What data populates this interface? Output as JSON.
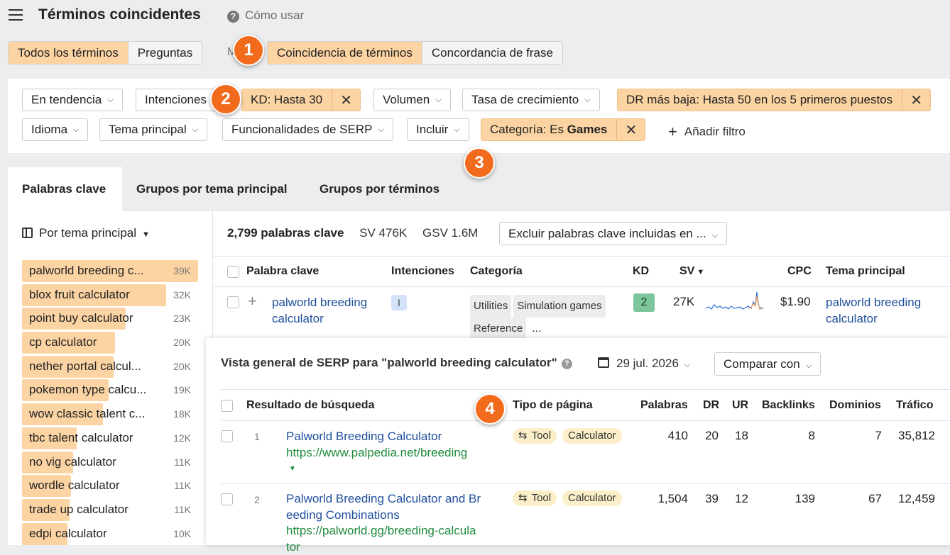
{
  "header": {
    "title": "Términos coincidentes",
    "help": "Cómo usar"
  },
  "mode_tabs": {
    "group1": [
      "Todos los términos",
      "Preguntas"
    ],
    "hidden_letter": "M",
    "group2": [
      "Coincidencia de términos",
      "Concordancia de frase"
    ]
  },
  "filters": {
    "trend": "En tendencia",
    "intents": "Intenciones",
    "kd": "KD: Hasta 30",
    "volume": "Volumen",
    "growth": "Tasa de crecimiento",
    "dr": "DR más baja: Hasta 50 en los 5 primeros puestos",
    "language": "Idioma",
    "parent_topic": "Tema principal",
    "serp_features": "Funcionalidades de SERP",
    "include": "Incluir",
    "category_prefix": "Categoría: Es ",
    "category_value": "Games",
    "add_filter": "Añadir filtro"
  },
  "main_tabs": [
    "Palabras clave",
    "Grupos por tema principal",
    "Grupos por términos"
  ],
  "sidebar": {
    "heading": "Por tema principal",
    "items": [
      {
        "label": "palworld breeding c...",
        "count": "39K",
        "fill": 1.0
      },
      {
        "label": "blox fruit calculator",
        "count": "32K",
        "fill": 0.82
      },
      {
        "label": "point buy calculator",
        "count": "23K",
        "fill": 0.59
      },
      {
        "label": "cp calculator",
        "count": "20K",
        "fill": 0.53
      },
      {
        "label": "nether portal calcul...",
        "count": "20K",
        "fill": 0.52
      },
      {
        "label": "pokemon type calcu...",
        "count": "19K",
        "fill": 0.49
      },
      {
        "label": "wow classic talent c...",
        "count": "18K",
        "fill": 0.46
      },
      {
        "label": "tbc talent calculator",
        "count": "12K",
        "fill": 0.31
      },
      {
        "label": "no vig calculator",
        "count": "11K",
        "fill": 0.29
      },
      {
        "label": "wordle calculator",
        "count": "11K",
        "fill": 0.28
      },
      {
        "label": "trade up calculator",
        "count": "11K",
        "fill": 0.27
      },
      {
        "label": "edpi calculator",
        "count": "10K",
        "fill": 0.26
      }
    ]
  },
  "summary": {
    "count": "2,799 palabras clave",
    "sv": "SV 476K",
    "gsv": "GSV 1.6M",
    "exclude": "Excluir palabras clave incluidas en ..."
  },
  "kw_table": {
    "headers": {
      "keyword": "Palabra clave",
      "intents": "Intenciones",
      "category": "Categoría",
      "kd": "KD",
      "sv": "SV",
      "cpc": "CPC",
      "parent": "Tema principal"
    },
    "row": {
      "keyword_line1": "palworld breeding",
      "keyword_line2": "calculator",
      "intent": "I",
      "tags": [
        "Utilities",
        "Simulation games",
        "Reference"
      ],
      "more": "...",
      "kd": "2",
      "sv": "27K",
      "cpc": "$1.90",
      "parent_line1": "palworld breeding",
      "parent_line2": "calculator",
      "kd_color": "#7dc59a"
    }
  },
  "serp": {
    "title": "Vista general de SERP para \"palworld breeding calculator\"",
    "date": "29 jul. 2026",
    "compare": "Comparar con",
    "headers": {
      "result": "Resultado de búsqueda",
      "page_type": "Tipo de página",
      "words": "Palabras",
      "dr": "DR",
      "ur": "UR",
      "backlinks": "Backlinks",
      "domains": "Dominios",
      "traffic": "Tráfico"
    },
    "rows": [
      {
        "rank": "1",
        "title_line1": "Palworld Breeding Calculator",
        "title_line2": "",
        "url_line1": "https://www.palpedia.net/breeding",
        "url_line2": "",
        "tags": [
          "Tool",
          "Calculator"
        ],
        "words": "410",
        "dr": "20",
        "ur": "18",
        "backlinks": "8",
        "domains": "7",
        "traffic": "35,812"
      },
      {
        "rank": "2",
        "title_line1": "Palworld Breeding Calculator and Br",
        "title_line2": "eeding Combinations",
        "url_line1": "https://palworld.gg/breeding-calcula",
        "url_line2": "tor",
        "tags": [
          "Tool",
          "Calculator"
        ],
        "words": "1,504",
        "dr": "39",
        "ur": "12",
        "backlinks": "139",
        "domains": "67",
        "traffic": "12,459"
      }
    ]
  },
  "callouts": [
    "1",
    "2",
    "3",
    "4"
  ],
  "colors": {
    "accent": "#fcd4a3",
    "callout": "#f26b1d",
    "link": "#1f4f9c",
    "url": "#1f8a3c"
  }
}
